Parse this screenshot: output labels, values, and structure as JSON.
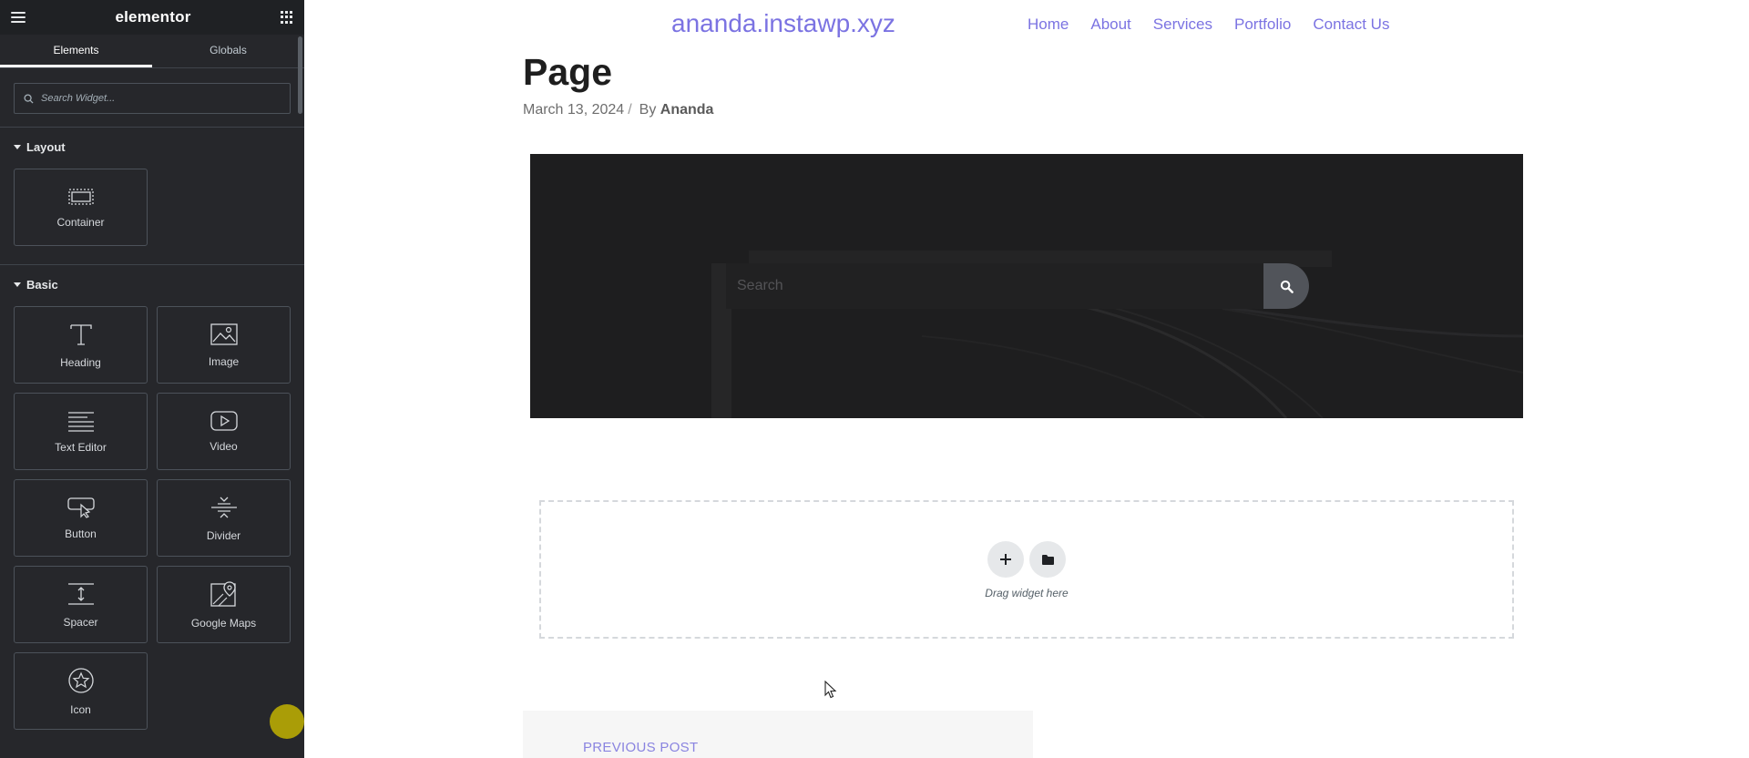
{
  "panel": {
    "logo": "elementor",
    "tabs": [
      {
        "label": "Elements"
      },
      {
        "label": "Globals"
      }
    ],
    "search": {
      "placeholder": "Search Widget..."
    },
    "sections": [
      {
        "title": "Layout",
        "widgets": [
          {
            "label": "Container",
            "icon": "container-icon"
          }
        ]
      },
      {
        "title": "Basic",
        "widgets": [
          {
            "label": "Heading",
            "icon": "heading-icon"
          },
          {
            "label": "Image",
            "icon": "image-icon"
          },
          {
            "label": "Text Editor",
            "icon": "text-editor-icon"
          },
          {
            "label": "Video",
            "icon": "video-icon"
          },
          {
            "label": "Button",
            "icon": "button-icon"
          },
          {
            "label": "Divider",
            "icon": "divider-icon"
          },
          {
            "label": "Spacer",
            "icon": "spacer-icon"
          },
          {
            "label": "Google Maps",
            "icon": "google-maps-icon"
          },
          {
            "label": "Icon",
            "icon": "star-icon"
          }
        ]
      }
    ]
  },
  "site": {
    "title": "ananda.instawp.xyz",
    "nav": [
      "Home",
      "About",
      "Services",
      "Portfolio",
      "Contact Us"
    ]
  },
  "post": {
    "title": "Page",
    "date": "March 13, 2024",
    "separator": "/",
    "by": "By",
    "author": "Ananda"
  },
  "hero": {
    "search_placeholder": "Search"
  },
  "dropzone": {
    "text": "Drag widget here"
  },
  "post_nav": {
    "previous": "PREVIOUS POST"
  },
  "colors": {
    "panel_bg": "#26272b",
    "link": "#7b73e2",
    "hero_bg": "#1e1e1f"
  }
}
